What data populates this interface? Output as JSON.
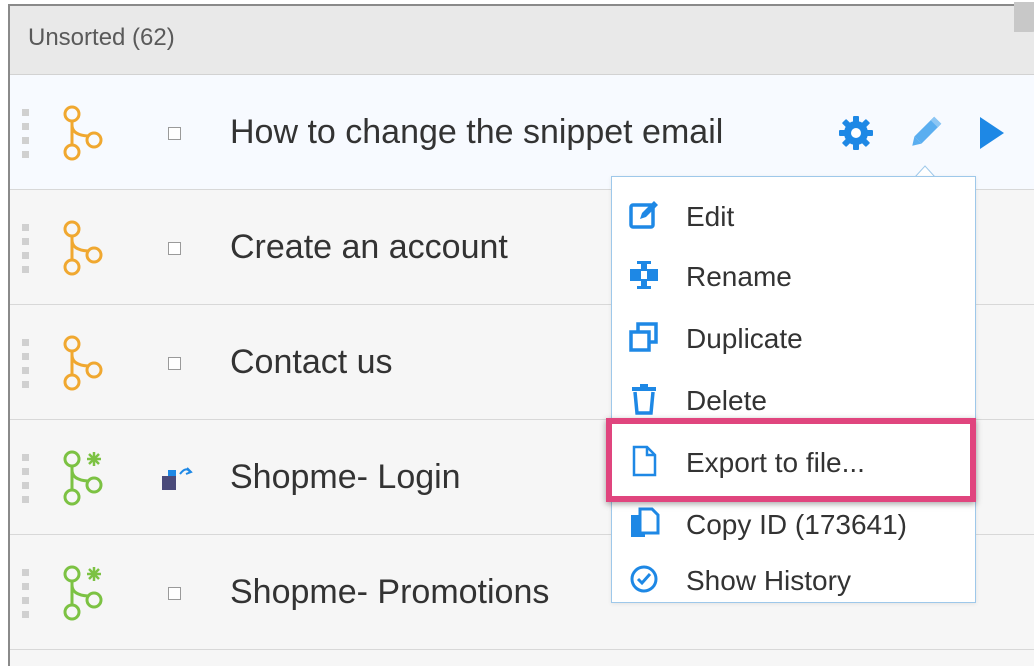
{
  "group": {
    "title": "Unsorted (62)"
  },
  "rows": [
    {
      "title": "How to change the snippet email",
      "icon": "flow-orange-icon",
      "status": "checkbox"
    },
    {
      "title": "Create an account",
      "icon": "flow-orange-icon",
      "status": "checkbox"
    },
    {
      "title": "Contact us",
      "icon": "flow-orange-icon",
      "status": "checkbox"
    },
    {
      "title": "Shopme- Login",
      "icon": "flow-green-icon",
      "status": "linked-module"
    },
    {
      "title": "Shopme- Promotions",
      "icon": "flow-green-icon",
      "status": "checkbox"
    }
  ],
  "context_menu": {
    "items": [
      {
        "label": "Edit",
        "icon": "edit-icon"
      },
      {
        "label": "Rename",
        "icon": "rename-icon"
      },
      {
        "label": "Duplicate",
        "icon": "duplicate-icon"
      },
      {
        "label": "Delete",
        "icon": "trash-icon"
      },
      {
        "label": "Export to file...",
        "icon": "file-icon",
        "highlighted": true
      },
      {
        "label": "Copy ID (173641)",
        "icon": "copy-icon"
      },
      {
        "label": "Show History",
        "icon": "clock-icon"
      }
    ]
  },
  "colors": {
    "accent_blue": "#1e88e5",
    "flow_orange": "#f0a830",
    "flow_green": "#7cc243",
    "highlight_pink": "#e0457e"
  }
}
